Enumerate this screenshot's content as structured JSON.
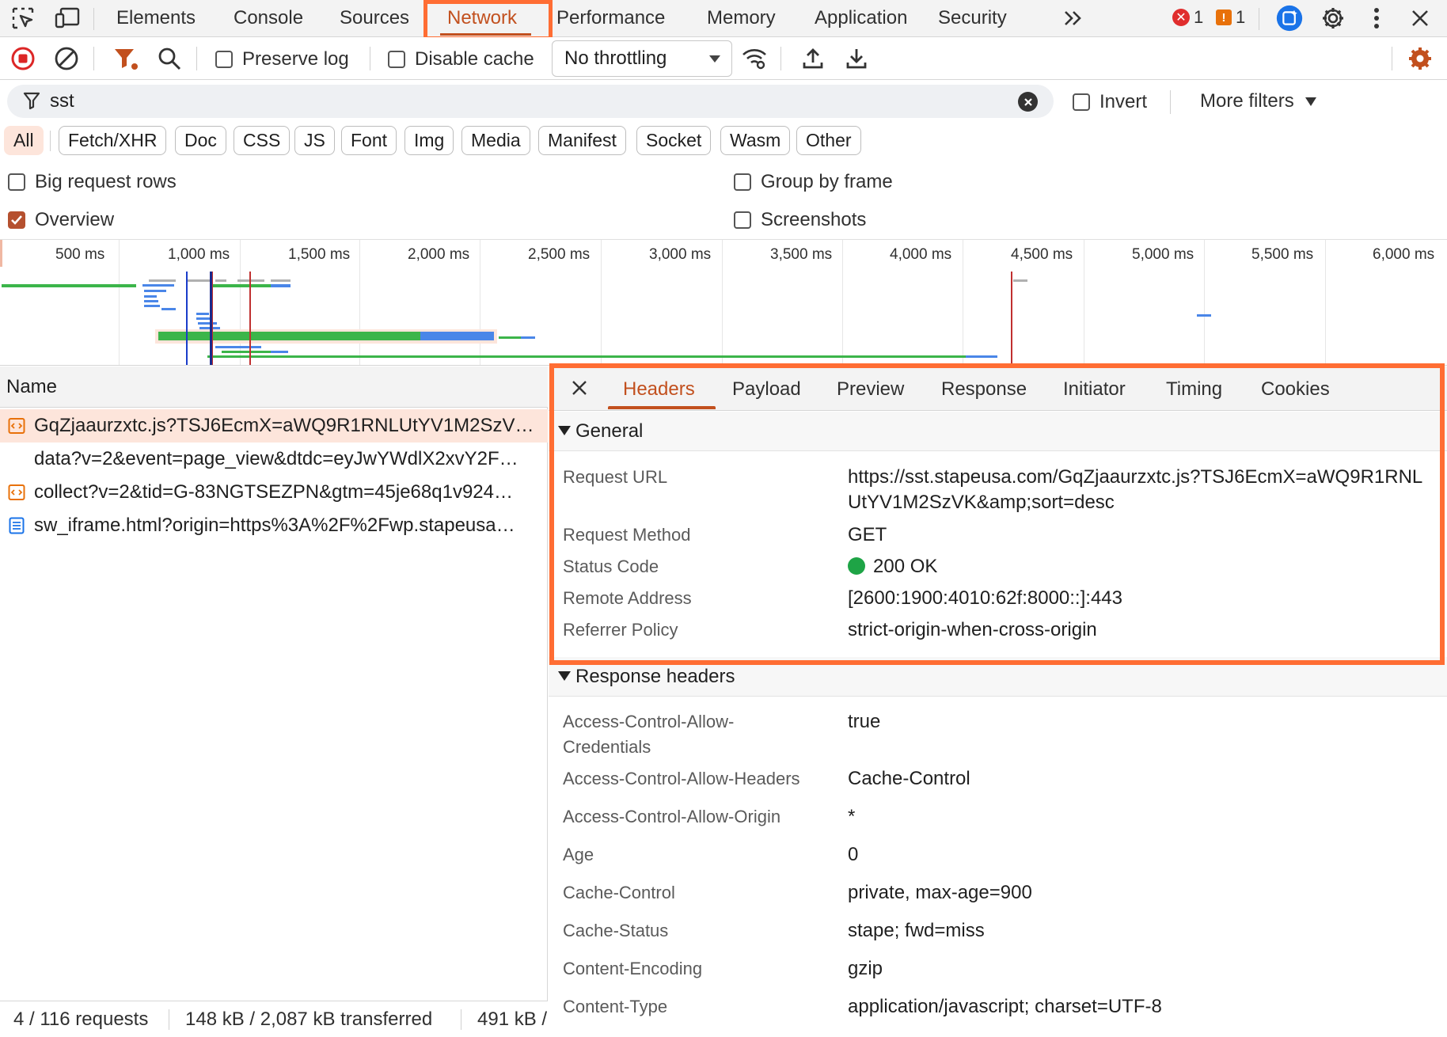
{
  "tabbar": {
    "tabs": [
      {
        "label": "Elements"
      },
      {
        "label": "Console"
      },
      {
        "label": "Sources"
      },
      {
        "label": "Network"
      },
      {
        "label": "Performance"
      },
      {
        "label": "Memory"
      },
      {
        "label": "Application"
      },
      {
        "label": "Security"
      }
    ],
    "more": "»",
    "error_count": "1",
    "warning_count": "1",
    "accent_color": "#c2501e",
    "highlight_color": "#ff6d33"
  },
  "toolbar": {
    "preserve_log": "Preserve log",
    "disable_cache": "Disable cache",
    "throttling": "No throttling"
  },
  "filter": {
    "value": "sst",
    "invert": "Invert",
    "more_filters": "More filters"
  },
  "chips": [
    "All",
    "Fetch/XHR",
    "Doc",
    "CSS",
    "JS",
    "Font",
    "Img",
    "Media",
    "Manifest",
    "Socket",
    "Wasm",
    "Other"
  ],
  "settings": {
    "big_rows": "Big request rows",
    "group_by_frame": "Group by frame",
    "overview": "Overview",
    "screenshots": "Screenshots"
  },
  "overview": {
    "ticks": [
      "500 ms",
      "1,000 ms",
      "1,500 ms",
      "2,000 ms",
      "2,500 ms",
      "3,000 ms",
      "3,500 ms",
      "4,000 ms",
      "4,500 ms",
      "5,000 ms",
      "5,500 ms",
      "6,000 ms"
    ]
  },
  "requests": {
    "header": "Name",
    "rows": [
      {
        "name": "GqZjaaurzxtc.js?TSJ6EcmX=aWQ9R1RNLUtYV1M2SzV…",
        "type": "script"
      },
      {
        "name": "data?v=2&event=page_view&dtdc=eyJwYWdlX2xvY2F…",
        "type": "none"
      },
      {
        "name": "collect?v=2&tid=G-83NGTSEZPN&gtm=45je68q1v924…",
        "type": "script"
      },
      {
        "name": "sw_iframe.html?origin=https%3A%2F%2Fwp.stapeusa…",
        "type": "document"
      }
    ]
  },
  "status": {
    "requests": "4 / 116 requests",
    "transferred": "148 kB / 2,087 kB transferred",
    "resources": "491 kB /"
  },
  "details": {
    "tabs": [
      "Headers",
      "Payload",
      "Preview",
      "Response",
      "Initiator",
      "Timing",
      "Cookies"
    ],
    "general_title": "General",
    "general": {
      "url_label": "Request URL",
      "url_line1": "https://sst.stapeusa.com/GqZjaaurzxtc.js?TSJ6EcmX=aWQ9R1RNL",
      "url_line2": "UtYV1M2SzVK&amp;sort=desc",
      "method_label": "Request Method",
      "method": "GET",
      "status_label": "Status Code",
      "status": "200 OK",
      "remote_label": "Remote Address",
      "remote": "[2600:1900:4010:62f:8000::]:443",
      "referrer_label": "Referrer Policy",
      "referrer": "strict-origin-when-cross-origin"
    },
    "response_title": "Response headers",
    "response": {
      "acac_label_1": "Access-Control-Allow-",
      "acac_label_2": "Credentials",
      "acac": "true",
      "acah_label": "Access-Control-Allow-Headers",
      "acah": "Cache-Control",
      "acao_label": "Access-Control-Allow-Origin",
      "acao": "*",
      "age_label": "Age",
      "age": "0",
      "cc_label": "Cache-Control",
      "cc": "private, max-age=900",
      "cs_label": "Cache-Status",
      "cs": "stape; fwd=miss",
      "ce_label": "Content-Encoding",
      "ce": "gzip",
      "ct_label": "Content-Type",
      "ct": "application/javascript; charset=UTF-8"
    }
  }
}
